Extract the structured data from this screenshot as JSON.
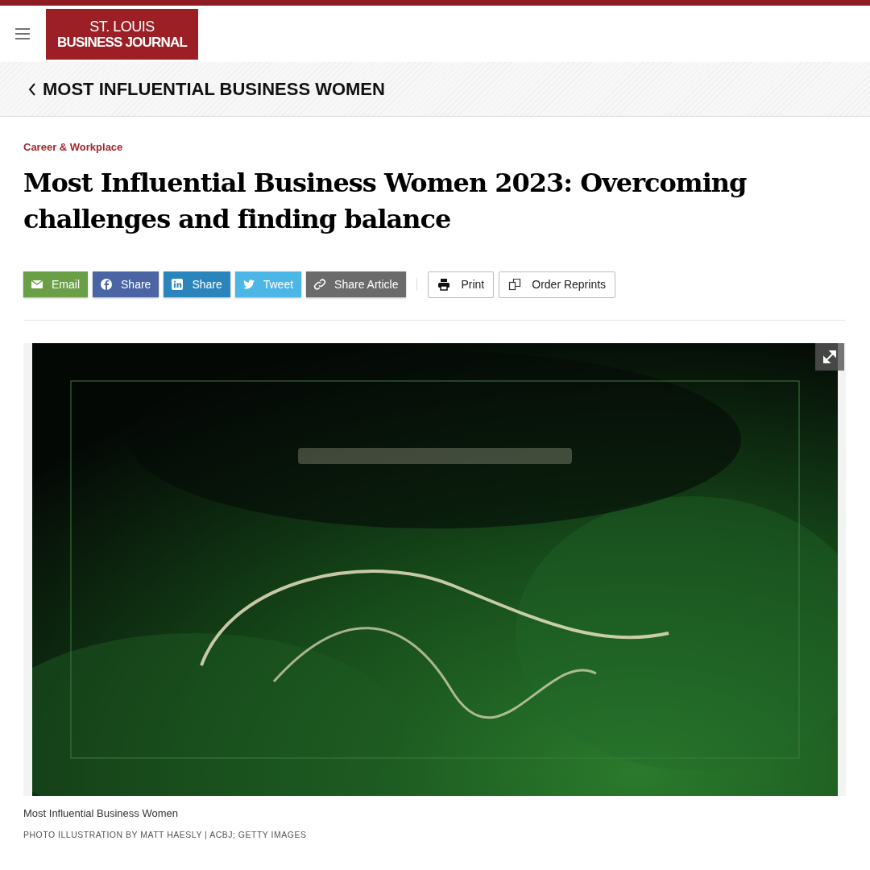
{
  "header": {
    "logo_line_1": "ST. LOUIS",
    "logo_line_2": "BUSINESS JOURNAL"
  },
  "section_bar": {
    "title": "MOST INFLUENTIAL BUSINESS WOMEN"
  },
  "article": {
    "category": "Career & Workplace",
    "headline": "Most Influential Business Women 2023: Overcoming challenges and finding balance",
    "share_buttons": [
      {
        "kind": "email",
        "label": "Email",
        "color": "#6a9e47"
      },
      {
        "kind": "facebook",
        "label": "Share",
        "color": "#4a64a4"
      },
      {
        "kind": "linkedin",
        "label": "Share",
        "color": "#2a85bd"
      },
      {
        "kind": "twitter",
        "label": "Tweet",
        "color": "#4cb7e6"
      },
      {
        "kind": "link",
        "label": "Share Article",
        "color": "#6b6b6b"
      }
    ],
    "tool_buttons": [
      {
        "kind": "print",
        "label": "Print"
      },
      {
        "kind": "reprints",
        "label": "Order Reprints"
      }
    ],
    "image": {
      "caption": "Most Influential Business Women",
      "credit": "PHOTO ILLUSTRATION BY MATT HAESLY | ACBJ; GETTY IMAGES"
    }
  }
}
